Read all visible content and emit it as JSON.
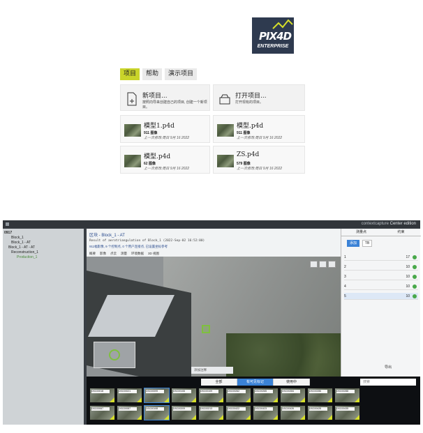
{
  "launcher": {
    "logo": {
      "brand": "PIX4D",
      "edition": "ENTERPRISE"
    },
    "tabs": [
      {
        "label": "项目",
        "active": true
      },
      {
        "label": "帮助",
        "active": false
      },
      {
        "label": "演示项目",
        "active": false
      }
    ],
    "actions": [
      {
        "title": "新项目...",
        "desc": "按照向导来创建自己的项目, 创建一个新项目。"
      },
      {
        "title": "打开项目...",
        "desc": "打开现有的项目。"
      }
    ],
    "recent": [
      {
        "name": "模型1.p4d",
        "count": "911 图像",
        "date": "上一次修改:周日 9月 16 2022"
      },
      {
        "name": "模型.p4d",
        "count": "911 图像",
        "date": "上一次修改:周日 9月 16 2022"
      },
      {
        "name": "模型.p4d",
        "count": "62 图像",
        "date": "上一次修改:周日 9月 16 2022"
      },
      {
        "name": "ZS.p4d",
        "count": "579 图像",
        "date": "上一次修改:周日 9月 16 2022"
      }
    ]
  },
  "app": {
    "title_brand": "contextcapture",
    "title_edition": "Center edition",
    "tree": [
      "0917",
      "Block_1",
      "Block_1 - AT",
      "Block_1 - AT - AT",
      "Reconstruction_1",
      "Production_1"
    ],
    "header": {
      "breadcrumb": "区块 - Block_1 - AT",
      "result": "Result of aerotriangulation of Block_1 (2022-Sep-02 16:52:00)",
      "stats": "911幅影像, 9 个控制点, 0 个用户连接点, 已设置坐标参考",
      "menu": [
        "概要",
        "影像",
        "点云",
        "测量",
        "环境数据",
        "3D 视图"
      ]
    },
    "viewport": {
      "comment_placeholder": "添加注释"
    },
    "side": {
      "tabs": [
        "测量点",
        "约束"
      ],
      "add_label": "添加",
      "type_label": "TB",
      "points": [
        "1",
        "2",
        "3",
        "4",
        "5"
      ],
      "point_values": [
        "17",
        "10",
        "10",
        "10",
        "10"
      ],
      "export_label": "导出"
    },
    "strip": {
      "segments": [
        {
          "label": "全部",
          "on": false
        },
        {
          "label": "有可见标记",
          "on": true
        },
        {
          "label": "使用中",
          "on": false
        }
      ],
      "search_placeholder": "搜索",
      "thumbs": [
        "DSC00018",
        "DSC00021",
        "DSC00099",
        "DSC00106",
        "DSC00109",
        "DSC00262",
        "DSC00265",
        "DSC00284",
        "DSC00286",
        "DSC00288",
        "DSC00067",
        "DSC00087",
        "DSC00108",
        "DSC00209",
        "DSC00213",
        "DSC00422",
        "DSC00423",
        "DSC00426",
        "DSC00428",
        "DSC00435"
      ]
    }
  }
}
